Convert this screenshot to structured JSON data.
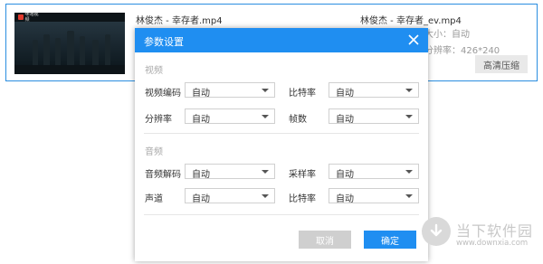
{
  "item": {
    "thumbnail_logo_text": "咪咕视频",
    "source_filename": "林俊杰 - 幸存者.mp4",
    "output_filename": "林俊杰 - 幸存者_ev.mp4",
    "size_label": "大小：自动",
    "resolution_label": "分辨率：426*240",
    "hq_button": "高清压缩"
  },
  "dialog": {
    "title": "参数设置",
    "video_section": "视频",
    "audio_section": "音频",
    "video_codec_label": "视频编码",
    "video_codec_value": "自动",
    "video_bitrate_label": "比特率",
    "video_bitrate_value": "自动",
    "resolution_label": "分辨率",
    "resolution_value": "自动",
    "framerate_label": "帧数",
    "framerate_value": "自动",
    "audio_codec_label": "音频解码",
    "audio_codec_value": "自动",
    "samplerate_label": "采样率",
    "samplerate_value": "自动",
    "channel_label": "声道",
    "channel_value": "自动",
    "audio_bitrate_label": "比特率",
    "audio_bitrate_value": "自动",
    "cancel_button": "取消",
    "ok_button": "确定"
  },
  "watermark": {
    "brand": "当下软件园",
    "site": "www.downxia.com"
  },
  "colors": {
    "accent": "#1f8ef1",
    "card_border": "#2a8ee0"
  }
}
